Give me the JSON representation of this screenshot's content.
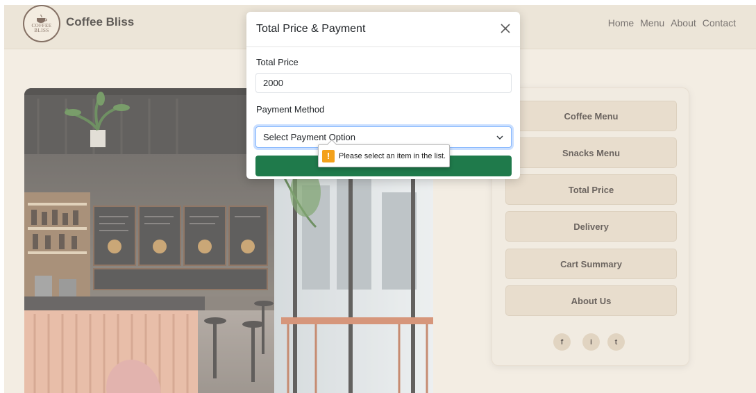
{
  "brand": {
    "name": "Coffee Bliss",
    "logo_line1": "COFFEE",
    "logo_line2": "BLISS"
  },
  "nav": {
    "links": [
      "Home",
      "Menu",
      "About",
      "Contact"
    ]
  },
  "sidebar": {
    "buttons": [
      "Coffee Menu",
      "Snacks Menu",
      "Total Price",
      "Delivery",
      "Cart Summary",
      "About Us"
    ],
    "social": [
      "f",
      "i",
      "t"
    ]
  },
  "modal": {
    "title": "Total Price & Payment",
    "total_price_label": "Total Price",
    "total_price_value": "2000",
    "payment_method_label": "Payment Method",
    "payment_select_value": "Select Payment Option"
  },
  "validation_tooltip": {
    "message": "Please select an item in the list.",
    "icon": "!"
  },
  "colors": {
    "page_bg": "#efe7da",
    "sidebar_button": "#e0d2bd",
    "submit_button": "#1f7a4b",
    "warning": "#f3a11b",
    "focus_border": "#86b7fe"
  },
  "icons": {
    "close": "close-icon",
    "chevron": "chevron-down-icon",
    "warning": "warning-icon"
  }
}
